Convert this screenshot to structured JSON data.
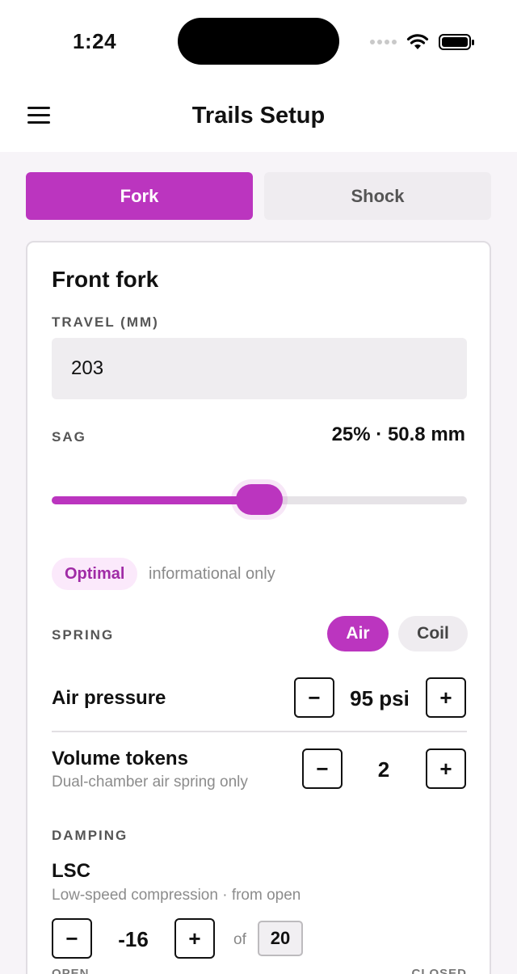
{
  "status_bar": {
    "time": "1:24"
  },
  "header": {
    "title": "Trails Setup"
  },
  "tabs": [
    {
      "label": "Fork",
      "active": true
    },
    {
      "label": "Shock",
      "active": false
    }
  ],
  "fork": {
    "title": "Front fork",
    "travel_label": "TRAVEL (MM)",
    "travel_value": "203",
    "sag_label": "SAG",
    "sag_value": "25% · 50.8 mm",
    "sag_slider_percent": 0.5,
    "status_badge": "Optimal",
    "status_note": "informational only",
    "spring_label": "SPRING",
    "spring_options": [
      "Air",
      "Coil"
    ],
    "spring_selected": "Air",
    "air_pressure": {
      "label": "Air pressure",
      "value": "95 psi"
    },
    "volume_tokens": {
      "label": "Volume tokens",
      "sub": "Dual-chamber air spring only",
      "value": "2"
    },
    "damping_label": "DAMPING",
    "lsc": {
      "label": "LSC",
      "sub": "Low-speed compression · from open",
      "value": "-16",
      "of": "of",
      "max": "20"
    },
    "scale_left": "OPEN",
    "scale_right": "CLOSED"
  },
  "colors": {
    "accent": "#bb35bf",
    "badge_bg": "#fbe9fb"
  },
  "icons": {
    "menu": "hamburger-menu-icon",
    "wifi": "wifi-icon",
    "battery": "battery-icon"
  }
}
